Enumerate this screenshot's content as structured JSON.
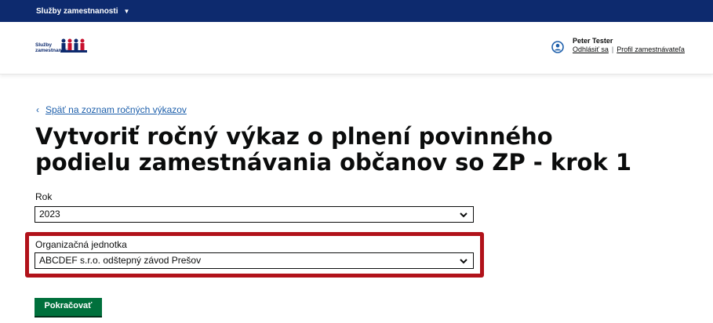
{
  "topbar": {
    "menu_label": "Služby zamestnanosti"
  },
  "header": {
    "logo_line1": "Služby",
    "logo_line2": "zamestnanosti",
    "user_name": "Peter Tester",
    "logout_label": "Odhlásiť sa",
    "separator": "|",
    "profile_label": "Profil zamestnávateľa"
  },
  "page": {
    "back_label": "Späť na zoznam ročných výkazov",
    "title": "Vytvoriť ročný výkaz o plnení povinného podielu zamestnávania občanov so ZP - krok 1"
  },
  "form": {
    "year_label": "Rok",
    "year_value": "2023",
    "unit_label": "Organizačná jednotka",
    "unit_value": "ABCDEF s.r.o. odštepný závod Prešov",
    "continue_label": "Pokračovať"
  },
  "colors": {
    "topbar": "#0d2a6e",
    "link": "#1d5fab",
    "highlight": "#b1121a",
    "button": "#00703c"
  },
  "icons": {
    "topbar_caret": "caret-down-icon",
    "user": "user-circle-icon",
    "back": "chevron-left-icon",
    "select": "chevron-down-icon"
  }
}
